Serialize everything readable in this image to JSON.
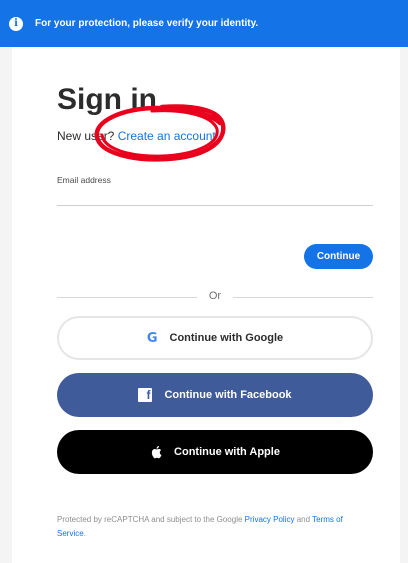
{
  "banner": {
    "info_icon": "i",
    "message": "For your protection, please verify your identity."
  },
  "signin": {
    "title": "Sign in",
    "new_user_prefix": "New user?",
    "create_account_link": "Create an account",
    "email_label": "Email address",
    "email_value": "",
    "continue_label": "Continue",
    "or_label": "Or"
  },
  "social": {
    "google_label": "Continue with Google",
    "facebook_label": "Continue with Facebook",
    "apple_label": "Continue with Apple"
  },
  "footer": {
    "prefix": "Protected by reCAPTCHA and subject to the Google",
    "privacy_link": "Privacy Policy",
    "and": "and",
    "terms_link": "Terms of Service",
    "suffix": "."
  },
  "colors": {
    "accent": "#1473e6",
    "facebook": "#3f5b9a",
    "apple": "#000000",
    "annotation": "#e8001c"
  }
}
